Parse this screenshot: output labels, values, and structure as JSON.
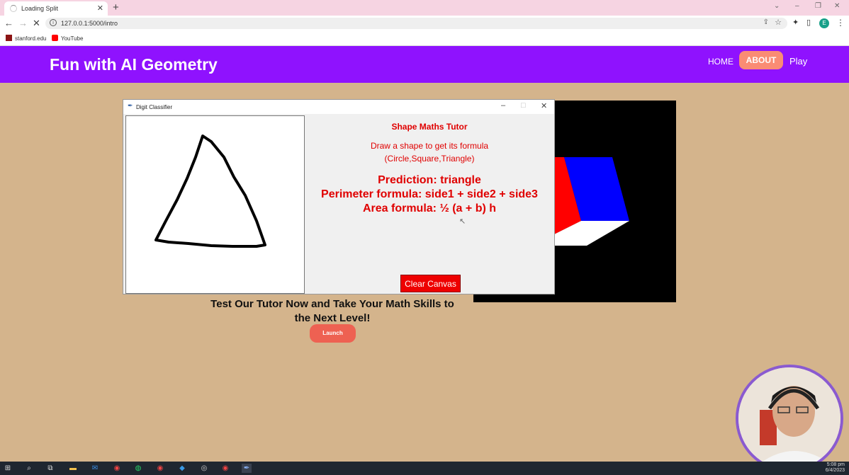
{
  "browser": {
    "tab_title": "Loading Split",
    "url": "127.0.0.1:5000/intro",
    "bookmarks": [
      "stanford.edu",
      "YouTube"
    ],
    "profile_initial": "E"
  },
  "site": {
    "brand": "Fun with AI Geometry",
    "nav": {
      "home": "HOME",
      "about": "ABOUT",
      "play": "Play"
    },
    "cta_line1": "Test Our Tutor Now and Take Your Math Skills to",
    "cta_line2": "the Next Level!",
    "launch_label": "Launch"
  },
  "tk_window": {
    "title": "Digit Classifier",
    "heading": "Shape Maths Tutor",
    "instruction_line1": "Draw a shape to get its formula",
    "instruction_line2": "(Circle,Square,Triangle)",
    "prediction": "Prediction: triangle",
    "perimeter": "Perimeter formula: side1 + side2 + side3",
    "area": "Area formula: ½ (a + b) h",
    "clear_label": "Clear Canvas"
  },
  "cube_colors": {
    "left": "#ff0000",
    "right": "#0000ff",
    "top": "#ffffff"
  },
  "taskbar": {
    "time": "5:08 pm",
    "date": "6/4/2023"
  }
}
